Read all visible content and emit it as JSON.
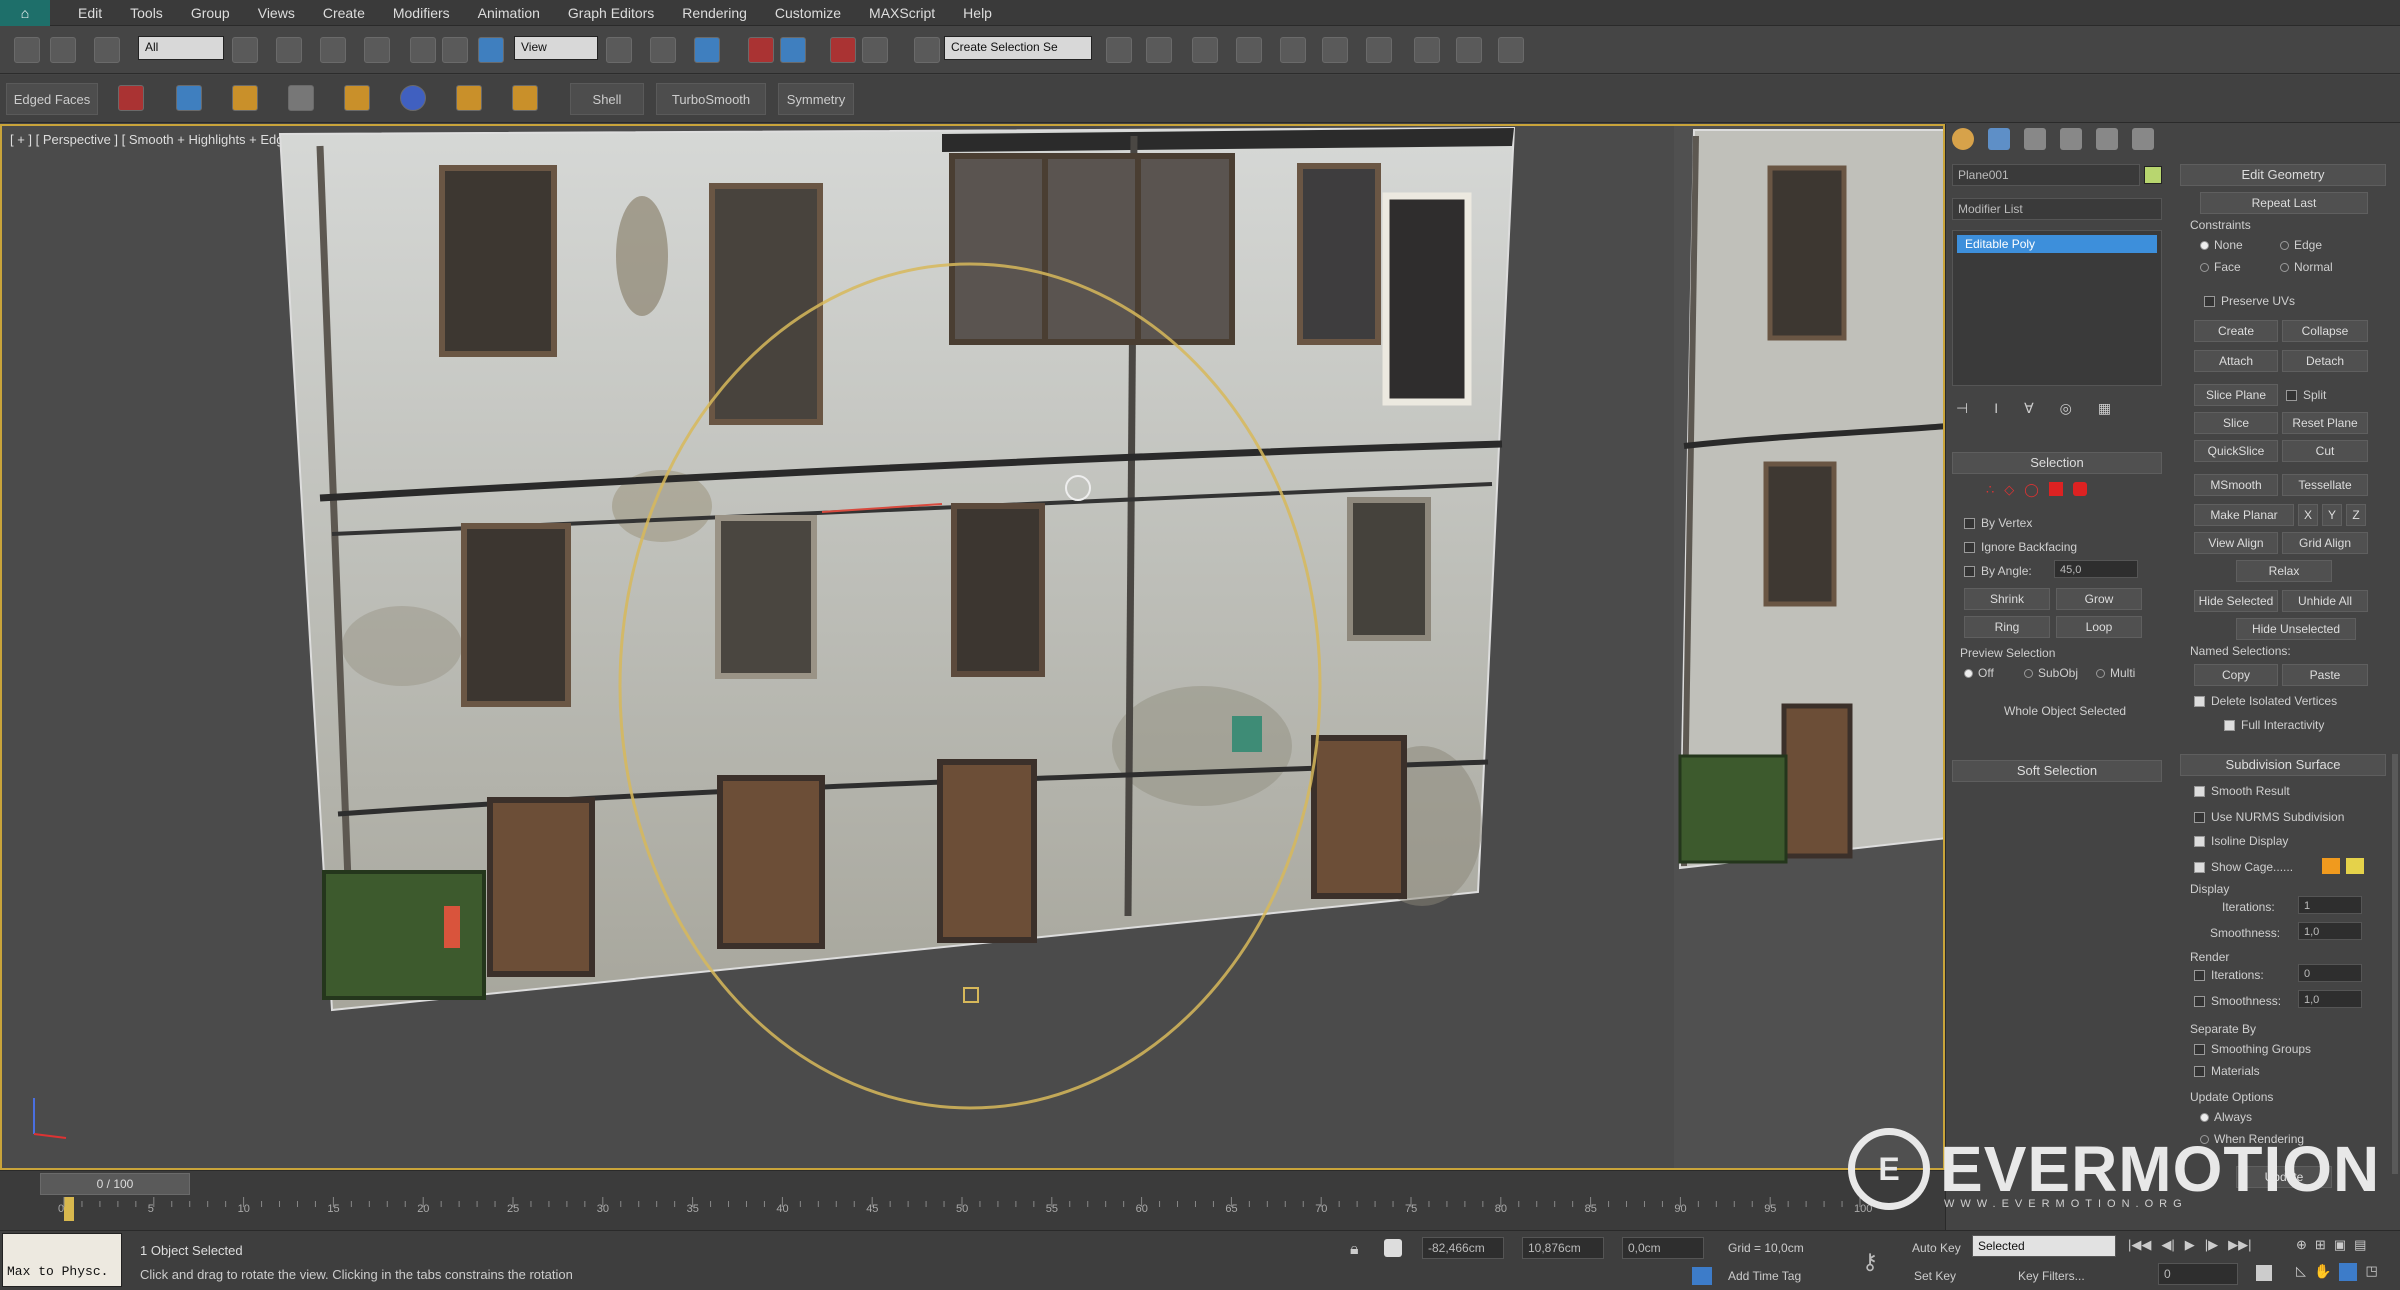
{
  "app": {
    "logo": "⌂"
  },
  "menu": [
    "Edit",
    "Tools",
    "Group",
    "Views",
    "Create",
    "Modifiers",
    "Animation",
    "Graph Editors",
    "Rendering",
    "Customize",
    "MAXScript",
    "Help"
  ],
  "toolbar": {
    "filter": "All",
    "ref_coord": "View",
    "named_selection": "Create Selection Se"
  },
  "toolbar2": [
    "Edged Faces",
    "Shell",
    "TurboSmooth",
    "Symmetry"
  ],
  "viewport": {
    "label": "[ + ] [ Perspective ] [ Smooth + Highlights + Edged Faces ]"
  },
  "timeline": {
    "frame": "0 / 100",
    "ticks": [
      "0",
      "5",
      "10",
      "15",
      "20",
      "25",
      "30",
      "35",
      "40",
      "45",
      "50",
      "55",
      "60",
      "65",
      "70",
      "75",
      "80",
      "85",
      "90",
      "95",
      "100"
    ]
  },
  "status": {
    "selected": "1 Object Selected",
    "prompt": "Click and drag to rotate the view.  Clicking in the tabs constrains the rotation",
    "maxscript": "Max to Physc.",
    "x": "-82,466cm",
    "y": "10,876cm",
    "z": "0,0cm",
    "grid": "Grid = 10,0cm",
    "auto_key": "Auto Key",
    "set_key": "Set Key",
    "selected_mode": "Selected",
    "key_filters": "Key Filters...",
    "add_time_tag": "Add Time Tag",
    "frame_field": "0"
  },
  "cmd": {
    "object_name": "Plane001",
    "modifier_list": "Modifier List",
    "stack_item": "Editable Poly",
    "selection": {
      "title": "Selection",
      "by_vertex": "By Vertex",
      "ignore_backfacing": "Ignore Backfacing",
      "by_angle": "By Angle:",
      "angle": "45,0",
      "shrink": "Shrink",
      "grow": "Grow",
      "ring": "Ring",
      "loop": "Loop",
      "preview": "Preview Selection",
      "off": "Off",
      "subobj": "SubObj",
      "multi": "Multi",
      "whole": "Whole Object Selected"
    },
    "soft_selection": "Soft Selection",
    "edit_geometry": {
      "title": "Edit Geometry",
      "repeat_last": "Repeat Last",
      "constraints": "Constraints",
      "none": "None",
      "edge": "Edge",
      "face": "Face",
      "normal": "Normal",
      "preserve_uvs": "Preserve UVs",
      "create": "Create",
      "collapse": "Collapse",
      "attach": "Attach",
      "detach": "Detach",
      "slice_plane": "Slice Plane",
      "split": "Split",
      "slice": "Slice",
      "reset_plane": "Reset Plane",
      "quickslice": "QuickSlice",
      "cut": "Cut",
      "msmooth": "MSmooth",
      "tessellate": "Tessellate",
      "make_planar": "Make Planar",
      "x": "X",
      "y": "Y",
      "z": "Z",
      "view_align": "View Align",
      "grid_align": "Grid Align",
      "relax": "Relax",
      "hide_selected": "Hide Selected",
      "unhide_all": "Unhide All",
      "hide_unselected": "Hide Unselected",
      "named_selections": "Named Selections:",
      "copy": "Copy",
      "paste": "Paste",
      "delete_isolated": "Delete Isolated Vertices",
      "full_interactivity": "Full Interactivity"
    },
    "subdivision": {
      "title": "Subdivision Surface",
      "smooth_result": "Smooth Result",
      "use_nurms": "Use NURMS Subdivision",
      "isoline": "Isoline Display",
      "show_cage": "Show Cage......",
      "display": "Display",
      "iterations": "Iterations:",
      "iter_val": "1",
      "smoothness": "Smoothness:",
      "smooth_val": "1,0",
      "render": "Render",
      "r_iter_val": "0",
      "r_smooth_val": "1,0",
      "separate_by": "Separate By",
      "smoothing_groups": "Smoothing Groups",
      "materials": "Materials",
      "update_options": "Update Options",
      "always": "Always",
      "when_rendering": "When Rendering",
      "update": "Update"
    }
  },
  "watermark": {
    "text": "EVERMOTION",
    "sub": "WWW.EVERMOTION.ORG"
  }
}
